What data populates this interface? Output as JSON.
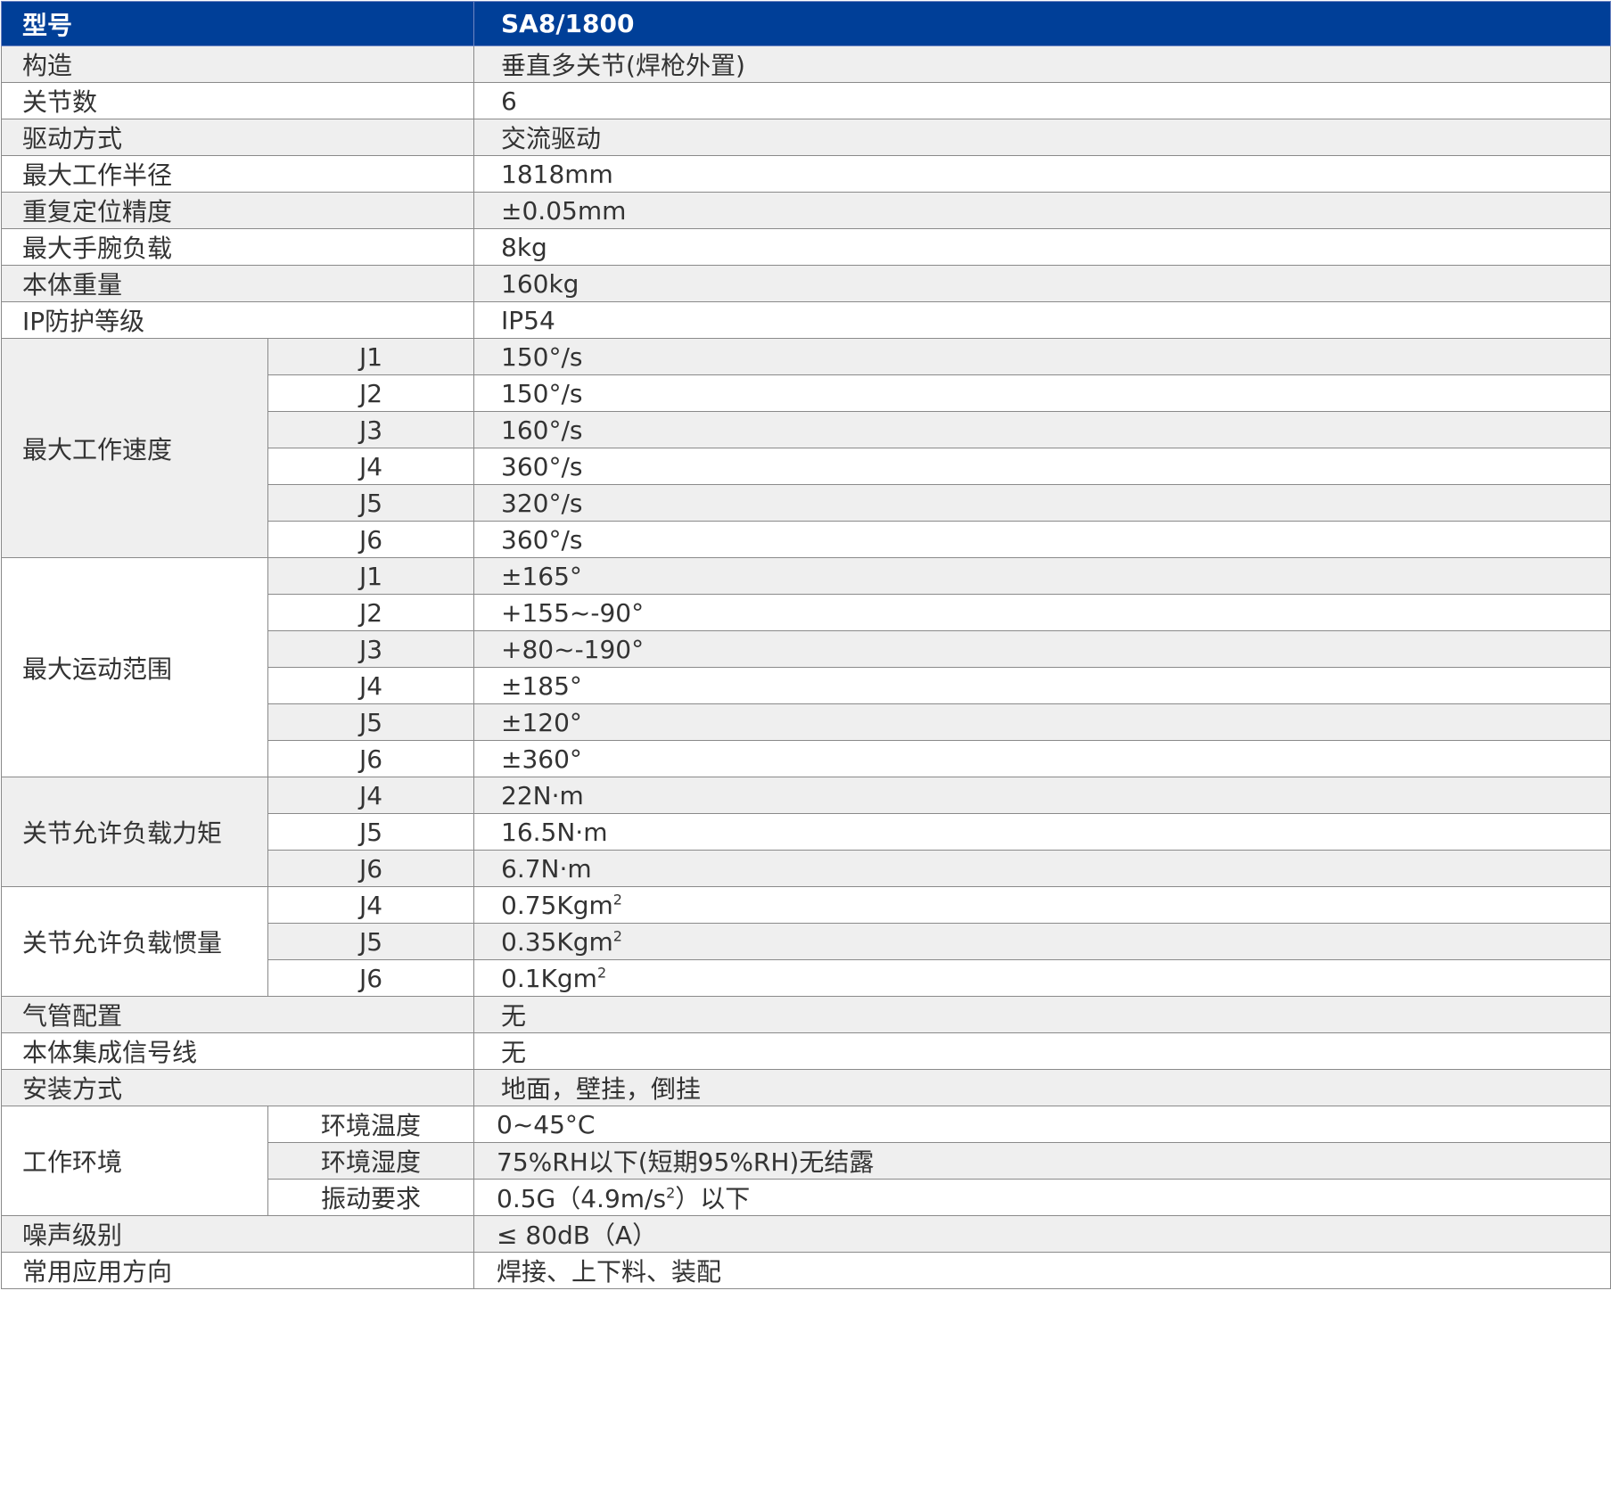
{
  "header": {
    "label": "型号",
    "value": "SA8/1800"
  },
  "rows": [
    {
      "label": "构造",
      "value": "垂直多关节(焊枪外置)"
    },
    {
      "label": "关节数",
      "value": "6"
    },
    {
      "label": "驱动方式",
      "value": "交流驱动"
    },
    {
      "label": "最大工作半径",
      "value": "1818mm"
    },
    {
      "label": "重复定位精度",
      "value": "±0.05mm"
    },
    {
      "label": "最大手腕负载",
      "value": "8kg"
    },
    {
      "label": "本体重量",
      "value": "160kg"
    },
    {
      "label": "IP防护等级",
      "value": "IP54"
    }
  ],
  "speed": {
    "label": "最大工作速度",
    "items": [
      {
        "axis": "J1",
        "value": "150°/s"
      },
      {
        "axis": "J2",
        "value": "150°/s"
      },
      {
        "axis": "J3",
        "value": "160°/s"
      },
      {
        "axis": "J4",
        "value": "360°/s"
      },
      {
        "axis": "J5",
        "value": "320°/s"
      },
      {
        "axis": "J6",
        "value": "360°/s"
      }
    ]
  },
  "range": {
    "label": "最大运动范围",
    "items": [
      {
        "axis": "J1",
        "value": "±165°"
      },
      {
        "axis": "J2",
        "value": "+155~-90°"
      },
      {
        "axis": "J3",
        "value": "+80~-190°"
      },
      {
        "axis": "J4",
        "value": "±185°"
      },
      {
        "axis": "J5",
        "value": "±120°"
      },
      {
        "axis": "J6",
        "value": "±360°"
      }
    ]
  },
  "torque": {
    "label": "关节允许负载力矩",
    "items": [
      {
        "axis": "J4",
        "value": "22N·m"
      },
      {
        "axis": "J5",
        "value": "16.5N·m"
      },
      {
        "axis": "J6",
        "value": "6.7N·m"
      }
    ]
  },
  "inertia": {
    "label": "关节允许负载惯量",
    "sup": "2",
    "items": [
      {
        "axis": "J4",
        "value": "0.75Kgm"
      },
      {
        "axis": "J5",
        "value": "0.35Kgm"
      },
      {
        "axis": "J6",
        "value": "0.1Kgm"
      }
    ]
  },
  "misc": [
    {
      "label": "气管配置",
      "value": "无"
    },
    {
      "label": "本体集成信号线",
      "value": "无"
    },
    {
      "label": "安装方式",
      "value": "地面，壁挂，倒挂"
    }
  ],
  "environment": {
    "label": "工作环境",
    "items": [
      {
        "name": "环境温度",
        "value": "0~45°C"
      },
      {
        "name": "环境湿度",
        "value": "75%RH以下(短期95%RH)无结露"
      },
      {
        "name": "振动要求",
        "value_pre": "0.5G（4.9m/s",
        "value_sup": "2",
        "value_post": "）以下"
      }
    ]
  },
  "tail": [
    {
      "label": "噪声级别",
      "value": "≤ 80dB（A）"
    },
    {
      "label": "常用应用方向",
      "value": "焊接、上下料、装配"
    }
  ]
}
